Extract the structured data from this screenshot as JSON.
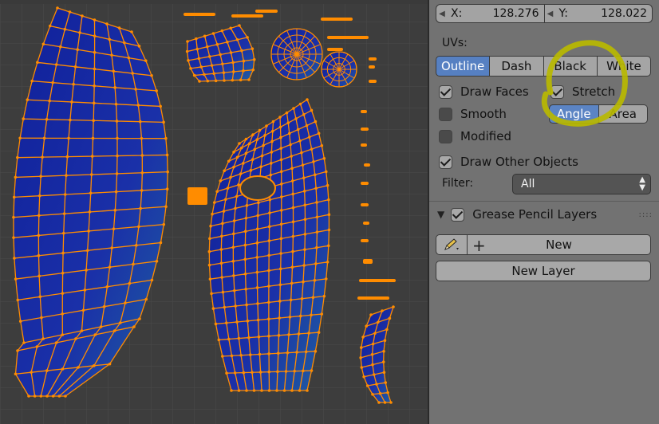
{
  "cursor": {
    "x_label": "X:",
    "x_value": "128.276",
    "y_label": "Y:",
    "y_value": "128.022"
  },
  "uvs": {
    "label": "UVs:",
    "draw_modes": [
      "Outline",
      "Dash",
      "Black",
      "White"
    ],
    "active_mode": "Outline"
  },
  "options": {
    "draw_faces": "Draw Faces",
    "stretch": "Stretch",
    "stretch_modes": [
      "Angle",
      "Area"
    ],
    "active_stretch": "Angle",
    "smooth": "Smooth",
    "modified": "Modified",
    "draw_other_objects": "Draw Other Objects"
  },
  "filter": {
    "label": "Filter:",
    "value": "All"
  },
  "grease_pencil": {
    "title": "Grease Pencil Layers",
    "new_label": "New",
    "new_layer_label": "New Layer"
  },
  "colors": {
    "uv_face": "#1a2a9a",
    "uv_edge": "#ff8c00",
    "annotation": "#b8b800",
    "active_button": "#5680c2"
  }
}
